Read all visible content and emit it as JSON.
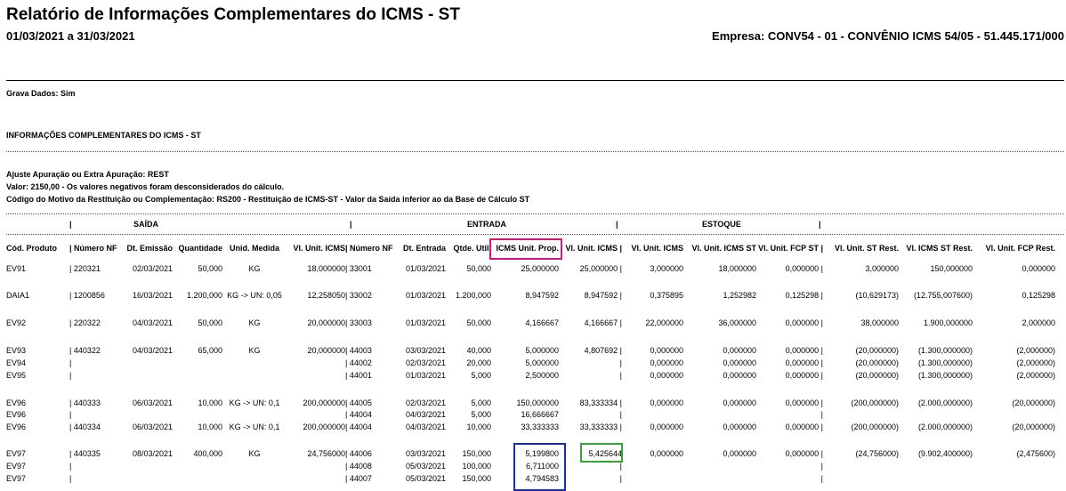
{
  "header": {
    "title": "Relatório de Informações Complementares do ICMS - ST",
    "period": "01/03/2021 a 31/03/2021",
    "empresa": "Empresa: CONV54 - 01 - CONVÊNIO ICMS 54/05 - 51.445.171/000"
  },
  "info": {
    "grava": "Grava Dados: Sim",
    "section": "INFORMAÇÕES COMPLEMENTARES DO ICMS - ST",
    "ajuste": "Ajuste Apuração ou Extra Apuração: REST",
    "valor": "Valor: 2150,00 - Os valores negativos foram desconsiderados do cálculo.",
    "codigo": "Código do Motivo da Restituição ou Complementação: RS200 - Restituição de ICMS-ST - Valor da Saída inferior ao da Base de Cálculo ST"
  },
  "groups": {
    "saida": "SAÍDA",
    "entrada": "ENTRADA",
    "estoque": "ESTOQUE",
    "sep": "|"
  },
  "columns": [
    "Cód. Produto",
    "| Número NF",
    "Dt. Emissão",
    "Quantidade",
    "Unid. Medida",
    "Vl. Unit. ICMS",
    "| Número NF",
    "Dt. Entrada",
    "Qtde. Util.",
    "ICMS Unit. Prop.",
    "Vl. Unit. ICMS |",
    "Vl. Unit. ICMS",
    "Vl. Unit. ICMS ST",
    "Vl. Unit. FCP ST |",
    "Vl. Unit. ST Rest.",
    "Vl. ICMS ST Rest.",
    "Vl. Unit. FCP Rest."
  ],
  "rows": [
    [
      "EV91",
      "| 220321",
      "02/03/2021",
      "50,000",
      "KG",
      "18,000000",
      "| 33001",
      "01/03/2021",
      "50,000",
      "25,000000",
      "25,000000 |",
      "3,000000",
      "18,000000",
      "0,000000 |",
      "3,000000",
      "150,000000",
      "0,000000"
    ],
    [
      "DAIA1",
      "| 1200856",
      "16/03/2021",
      "1.200,000",
      "KG -> UN: 0,05",
      "12,258050",
      "| 33002",
      "01/03/2021",
      "1.200,000",
      "8,947592",
      "8,947592 |",
      "0,375895",
      "1,252982",
      "0,125298 |",
      "(10,629173)",
      "(12.755,007600)",
      "0,125298"
    ],
    [
      "EV92",
      "| 220322",
      "04/03/2021",
      "50,000",
      "KG",
      "20,000000",
      "| 33003",
      "01/03/2021",
      "50,000",
      "4,166667",
      "4,166667 |",
      "22,000000",
      "36,000000",
      "0,000000 |",
      "38,000000",
      "1.900,000000",
      "2,000000"
    ],
    [
      "EV93",
      "| 440322",
      "04/03/2021",
      "65,000",
      "KG",
      "20,000000",
      "| 44003",
      "03/03/2021",
      "40,000",
      "5,000000",
      "4,807692 |",
      "0,000000",
      "0,000000",
      "0,000000 |",
      "(20,000000)",
      "(1.300,000000)",
      "(2,000000)"
    ],
    [
      "  EV94",
      "|",
      "",
      "",
      "",
      "",
      "| 44002",
      "02/03/2021",
      "20,000",
      "5,000000",
      "|",
      "0,000000",
      "0,000000",
      "0,000000 |",
      "(20,000000)",
      "(1.300,000000)",
      "(2,000000)"
    ],
    [
      "  EV95",
      "|",
      "",
      "",
      "",
      "",
      "| 44001",
      "01/03/2021",
      "5,000",
      "2,500000",
      "|",
      "0,000000",
      "0,000000",
      "0,000000 |",
      "(20,000000)",
      "(1.300,000000)",
      "(2,000000)"
    ],
    [
      "EV96",
      "| 440333",
      "06/03/2021",
      "10,000",
      "KG -> UN: 0,1",
      "200,000000",
      "| 44005",
      "02/03/2021",
      "5,000",
      "150,000000",
      "83,333334 |",
      "0,000000",
      "0,000000",
      "0,000000 |",
      "(200,000000)",
      "(2.000,000000)",
      "(20,000000)"
    ],
    [
      "EV96",
      "|",
      "",
      "",
      "",
      "",
      "| 44004",
      "04/03/2021",
      "5,000",
      "16,666667",
      "|",
      "",
      "",
      "|",
      "",
      "",
      ""
    ],
    [
      "EV96",
      "| 440334",
      "06/03/2021",
      "10,000",
      "KG -> UN: 0,1",
      "200,000000",
      "| 44004",
      "04/03/2021",
      "10,000",
      "33,333333",
      "33,333333 |",
      "0,000000",
      "0,000000",
      "0,000000 |",
      "(200,000000)",
      "(2.000,000000)",
      "(20,000000)"
    ],
    [
      "EV97",
      "| 440335",
      "08/03/2021",
      "400,000",
      "KG",
      "24,756000",
      "| 44006",
      "03/03/2021",
      "150,000",
      "5,199800",
      "5,425644",
      "0,000000",
      "0,000000",
      "0,000000 |",
      "(24,756000)",
      "(9.902,400000)",
      "(2,475600)"
    ],
    [
      "EV97",
      "|",
      "",
      "",
      "",
      "",
      "| 44008",
      "05/03/2021",
      "100,000",
      "6,711000",
      "|",
      "",
      "",
      "|",
      "",
      "",
      ""
    ],
    [
      "EV97",
      "|",
      "",
      "",
      "",
      "",
      "| 44007",
      "05/03/2021",
      "150,000",
      "4,794583",
      "|",
      "",
      "",
      "|",
      "",
      "",
      ""
    ]
  ],
  "highlight_colors": {
    "header_box": "#d0187b",
    "prop_box": "#1a2ea8",
    "unit_box": "#3aa336"
  }
}
